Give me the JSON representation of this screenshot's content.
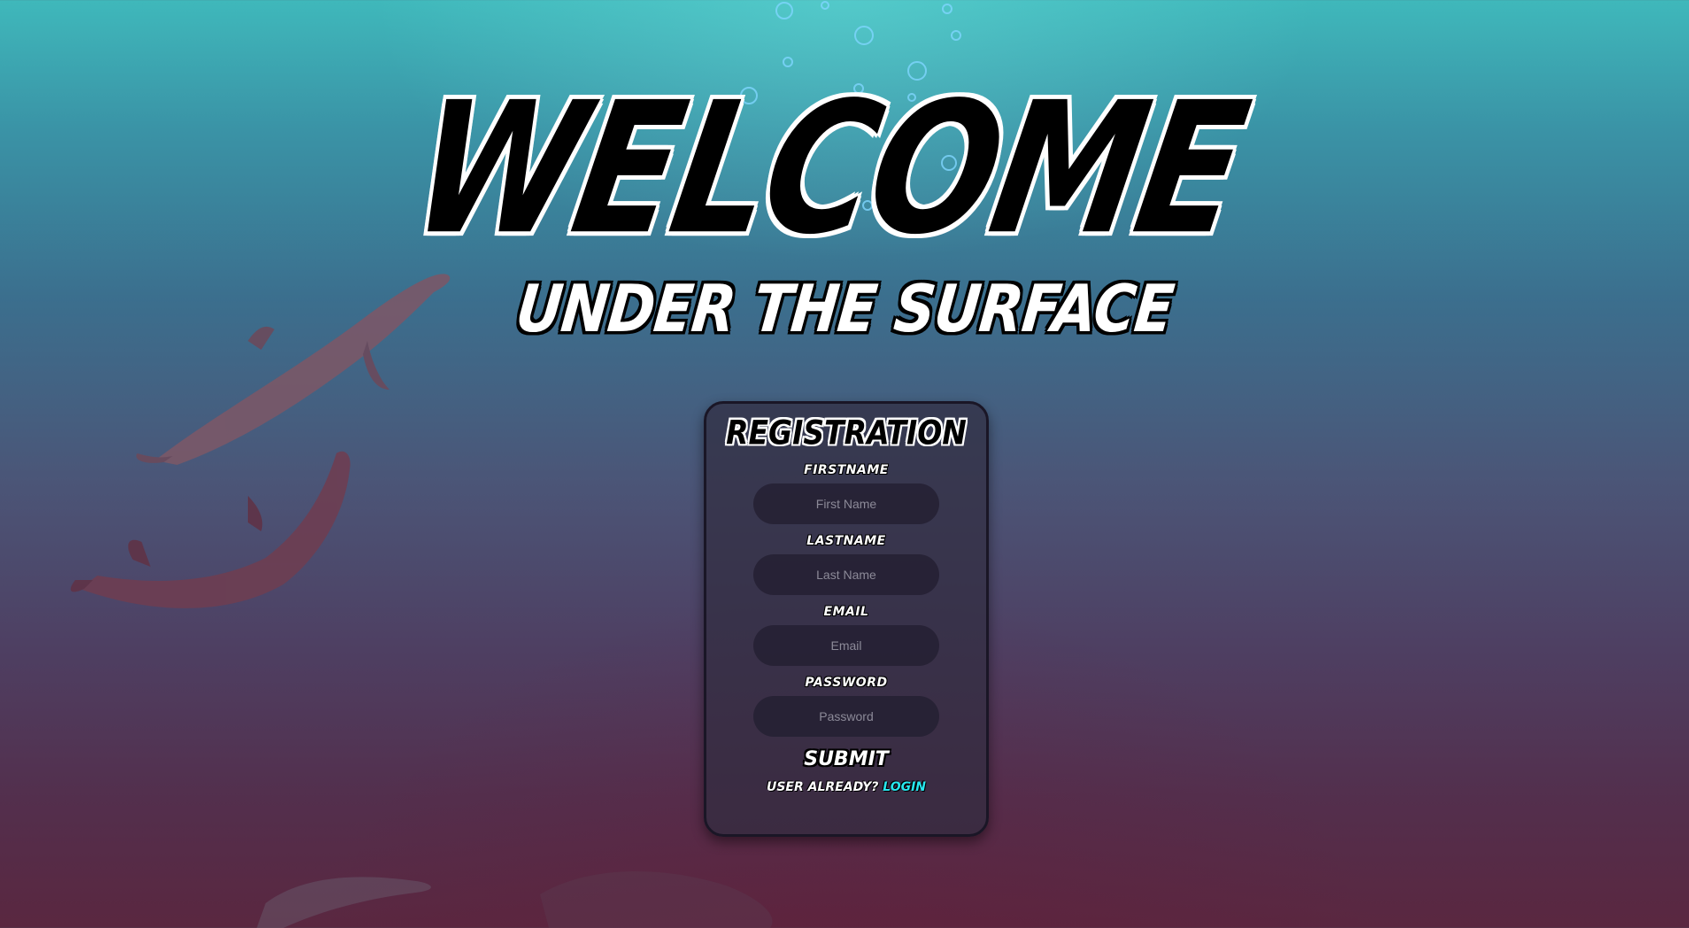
{
  "hero": {
    "title": "WELCOME",
    "subtitle": "UNDER THE SURFACE"
  },
  "registration": {
    "title": "Registration",
    "fields": [
      {
        "label": "Firstname",
        "placeholder": "First Name",
        "value": ""
      },
      {
        "label": "Lastname",
        "placeholder": "Last Name",
        "value": ""
      },
      {
        "label": "Email",
        "placeholder": "Email",
        "value": ""
      },
      {
        "label": "Password",
        "placeholder": "Password",
        "value": ""
      }
    ],
    "submit_label": "Submit",
    "login_prompt": "User already?",
    "login_link": "Login"
  },
  "colors": {
    "link": "#27e7ee",
    "card_background": "#302c40",
    "input_background": "#242032"
  }
}
